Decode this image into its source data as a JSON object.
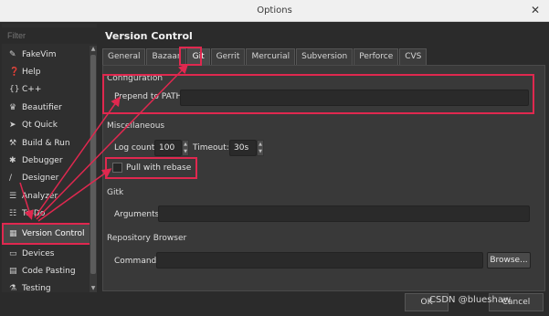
{
  "window": {
    "title": "Options",
    "close_glyph": "✕"
  },
  "sidebar": {
    "filter_placeholder": "Filter",
    "items": [
      {
        "label": "FakeVim",
        "icon": "fakevim-icon",
        "glyph": "✎"
      },
      {
        "label": "Help",
        "icon": "help-icon",
        "glyph": "❓"
      },
      {
        "label": "C++",
        "icon": "cpp-icon",
        "glyph": "{}"
      },
      {
        "label": "Beautifier",
        "icon": "beautifier-icon",
        "glyph": "♛"
      },
      {
        "label": "Qt Quick",
        "icon": "qtquick-icon",
        "glyph": "➤"
      },
      {
        "label": "Build & Run",
        "icon": "build-run-icon",
        "glyph": "⚒"
      },
      {
        "label": "Debugger",
        "icon": "debugger-icon",
        "glyph": "✱"
      },
      {
        "label": "Designer",
        "icon": "designer-icon",
        "glyph": "∕"
      },
      {
        "label": "Analyzer",
        "icon": "analyzer-icon",
        "glyph": "☰"
      },
      {
        "label": "To-Do",
        "icon": "todo-icon",
        "glyph": "☷"
      },
      {
        "label": "Version Control",
        "icon": "version-control-icon",
        "glyph": "▦"
      },
      {
        "label": "Devices",
        "icon": "devices-icon",
        "glyph": "▭"
      },
      {
        "label": "Code Pasting",
        "icon": "code-pasting-icon",
        "glyph": "▤"
      },
      {
        "label": "Testing",
        "icon": "testing-icon",
        "glyph": "⚗"
      }
    ],
    "active_index": 10
  },
  "panel": {
    "heading": "Version Control",
    "tabs": [
      "General",
      "Bazaar",
      "Git",
      "Gerrit",
      "Mercurial",
      "Subversion",
      "Perforce",
      "CVS"
    ],
    "active_tab": 2,
    "configuration": {
      "title": "Configuration",
      "prepend_label": "Prepend to PATH:",
      "prepend_value": ""
    },
    "misc": {
      "title": "Miscellaneous",
      "log_count_label": "Log count:",
      "log_count_value": "100",
      "timeout_label": "Timeout:",
      "timeout_value": "30s",
      "pull_rebase_label": "Pull with rebase",
      "pull_rebase_checked": false
    },
    "gitk": {
      "title": "Gitk",
      "arguments_label": "Arguments:",
      "arguments_value": ""
    },
    "repo_browser": {
      "title": "Repository Browser",
      "command_label": "Command:",
      "command_value": "",
      "browse_label": "Browse..."
    }
  },
  "footer": {
    "ok_label": "OK",
    "cancel_label": "Cancel"
  },
  "watermark": "CSDN @blueshaw",
  "colors": {
    "highlight": "#e0284f",
    "background": "#2b2b2b"
  }
}
